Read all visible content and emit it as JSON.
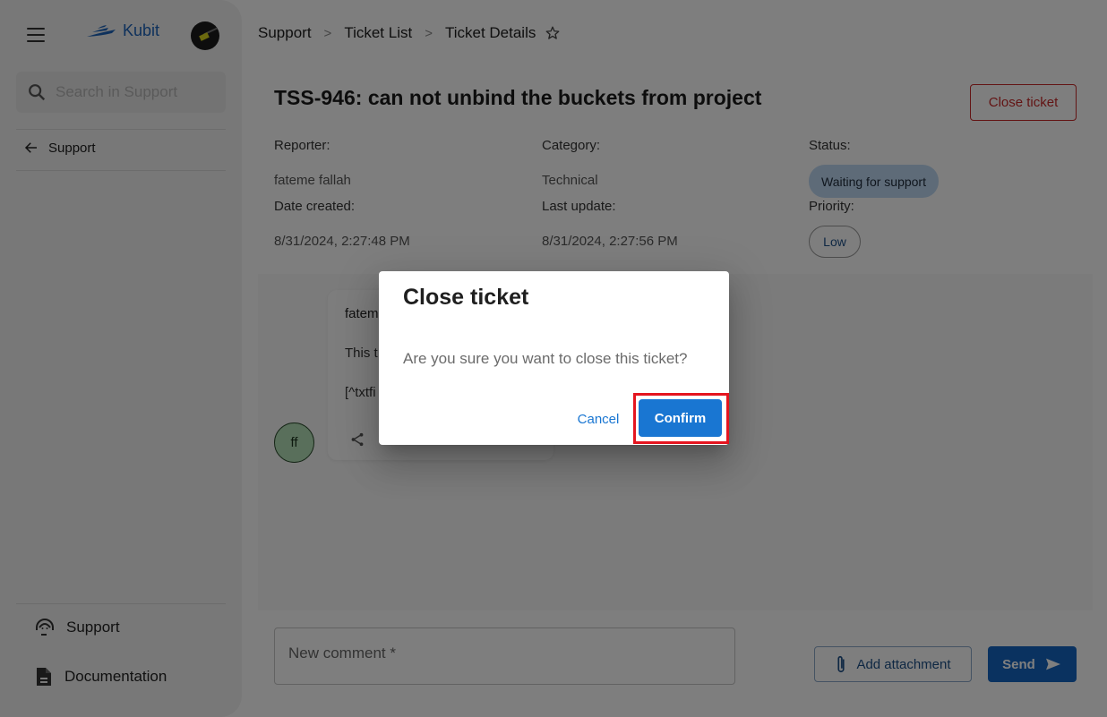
{
  "app": {
    "brand": "Kubit",
    "accent_color": "#1976d2",
    "danger_color": "#c62828"
  },
  "sidebar": {
    "search_placeholder": "Search in Support",
    "back_label": "Support",
    "bottom_items": [
      {
        "label": "Support",
        "icon": "headset-icon"
      },
      {
        "label": "Documentation",
        "icon": "document-icon"
      }
    ]
  },
  "breadcrumb": {
    "items": [
      "Support",
      "Ticket List",
      "Ticket Details"
    ]
  },
  "ticket": {
    "title": "TSS-946: can not unbind the buckets from project",
    "close_button": "Close ticket",
    "reporter_label": "Reporter:",
    "reporter": "fateme fallah",
    "category_label": "Category:",
    "category": "Technical",
    "status_label": "Status:",
    "status": "Waiting for support",
    "date_created_label": "Date created:",
    "date_created": "8/31/2024, 2:27:48 PM",
    "last_update_label": "Last update:",
    "last_update": "8/31/2024, 2:27:56 PM",
    "priority_label": "Priority:",
    "priority": "Low"
  },
  "comments": [
    {
      "author_partial": "fatem",
      "body_partial": "This t",
      "attachment_partial": "[^txtfi",
      "avatar_initials": "ff"
    }
  ],
  "composer": {
    "placeholder": "New comment *",
    "attach_label": "Add attachment",
    "send_label": "Send"
  },
  "dialog": {
    "title": "Close ticket",
    "message": "Are you sure you want to close this ticket?",
    "cancel_label": "Cancel",
    "confirm_label": "Confirm"
  }
}
